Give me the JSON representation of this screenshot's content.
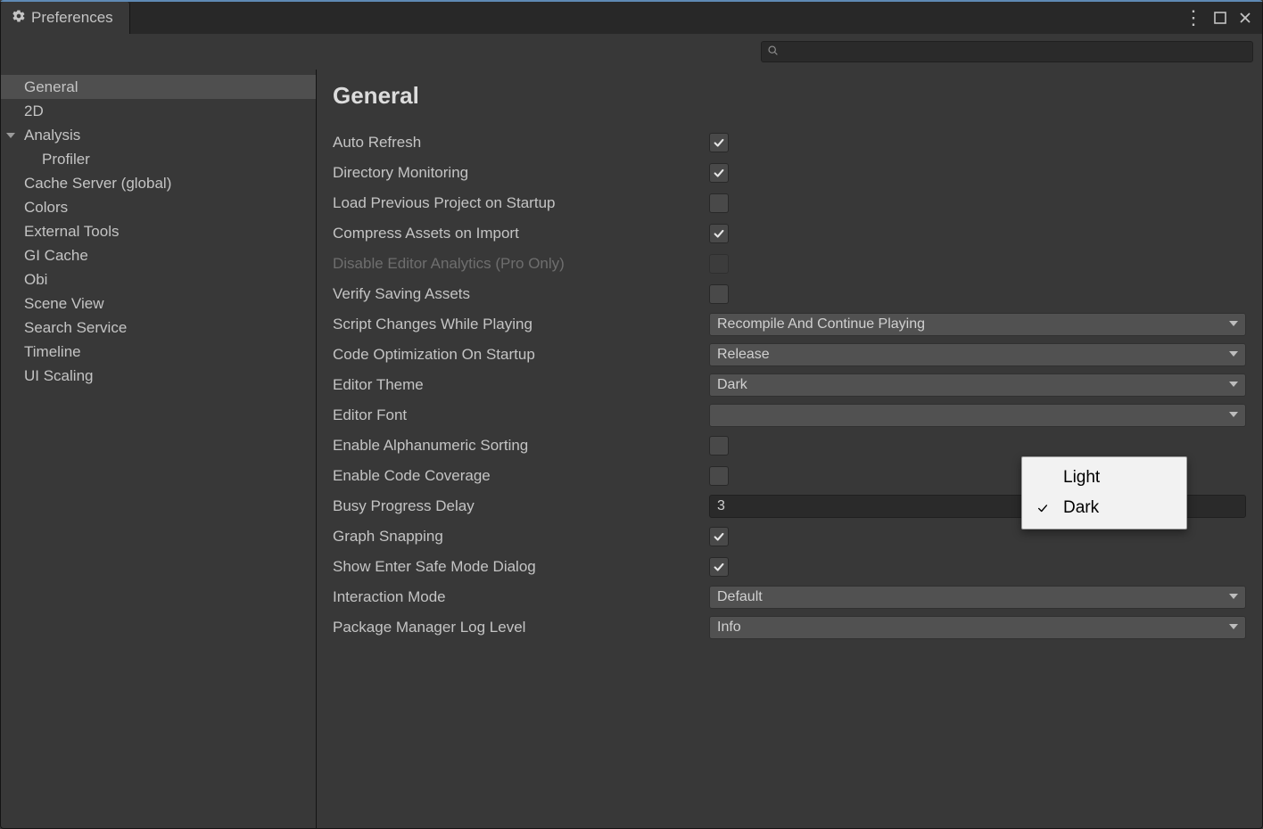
{
  "header": {
    "tab_title": "Preferences"
  },
  "search": {
    "placeholder": ""
  },
  "sidebar": {
    "items": [
      {
        "label": "General",
        "selected": true
      },
      {
        "label": "2D"
      },
      {
        "label": "Analysis",
        "expandable": true,
        "expanded": true
      },
      {
        "label": "Profiler",
        "child": true
      },
      {
        "label": "Cache Server (global)"
      },
      {
        "label": "Colors"
      },
      {
        "label": "External Tools"
      },
      {
        "label": "GI Cache"
      },
      {
        "label": "Obi"
      },
      {
        "label": "Scene View"
      },
      {
        "label": "Search Service"
      },
      {
        "label": "Timeline"
      },
      {
        "label": "UI Scaling"
      }
    ]
  },
  "main": {
    "title": "General",
    "fields": [
      {
        "kind": "checkbox",
        "label": "Auto Refresh",
        "checked": true
      },
      {
        "kind": "checkbox",
        "label": "Directory Monitoring",
        "checked": true
      },
      {
        "kind": "checkbox",
        "label": "Load Previous Project on Startup",
        "checked": false
      },
      {
        "kind": "checkbox",
        "label": "Compress Assets on Import",
        "checked": true
      },
      {
        "kind": "checkbox",
        "label": "Disable Editor Analytics (Pro Only)",
        "checked": false,
        "disabled": true
      },
      {
        "kind": "checkbox",
        "label": "Verify Saving Assets",
        "checked": false
      },
      {
        "kind": "dropdown",
        "label": "Script Changes While Playing",
        "value": "Recompile And Continue Playing"
      },
      {
        "kind": "dropdown",
        "label": "Code Optimization On Startup",
        "value": "Release"
      },
      {
        "kind": "dropdown",
        "label": "Editor Theme",
        "value": "Dark"
      },
      {
        "kind": "dropdown",
        "label": "Editor Font",
        "value": ""
      },
      {
        "kind": "checkbox",
        "label": "Enable Alphanumeric Sorting",
        "checked": false
      },
      {
        "kind": "checkbox",
        "label": "Enable Code Coverage",
        "checked": false
      },
      {
        "kind": "text",
        "label": "Busy Progress Delay",
        "value": "3"
      },
      {
        "kind": "checkbox",
        "label": "Graph Snapping",
        "checked": true
      },
      {
        "kind": "checkbox",
        "label": "Show Enter Safe Mode Dialog",
        "checked": true
      },
      {
        "kind": "dropdown",
        "label": "Interaction Mode",
        "value": "Default"
      },
      {
        "kind": "dropdown",
        "label": "Package Manager Log Level",
        "value": "Info"
      }
    ]
  },
  "popup": {
    "items": [
      {
        "label": "Light",
        "checked": false
      },
      {
        "label": "Dark",
        "checked": true
      }
    ]
  }
}
